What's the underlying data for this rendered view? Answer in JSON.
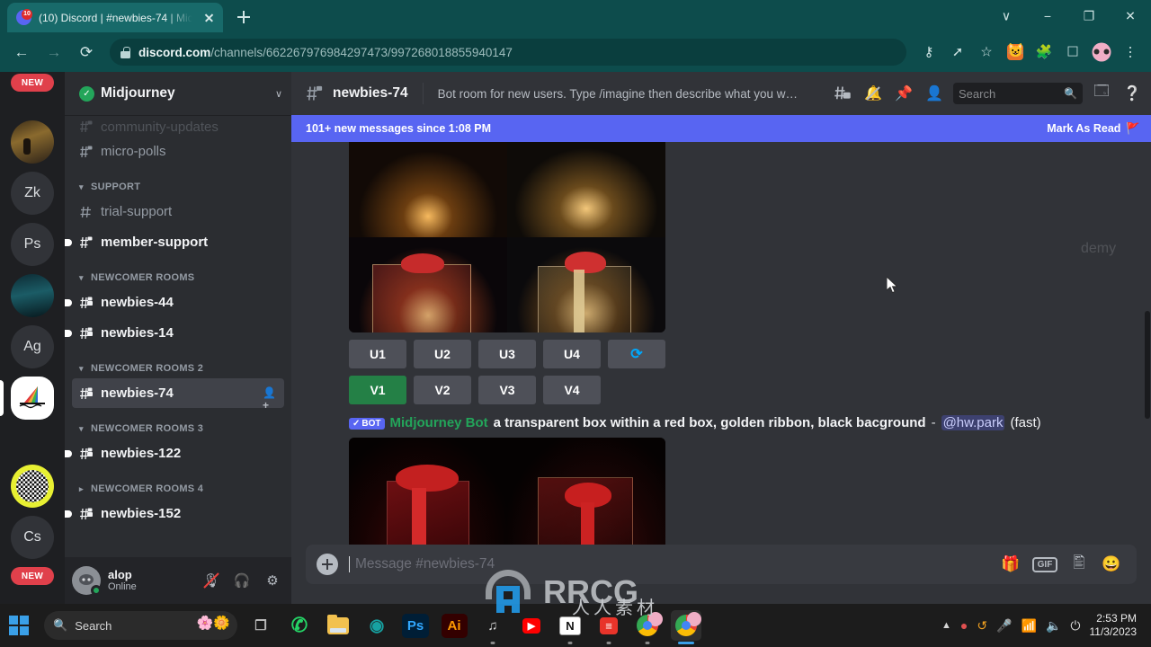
{
  "browser": {
    "tab": {
      "title": "(10) Discord | #newbies-74 | Mid",
      "badge": "10"
    },
    "url_bold": "discord.com",
    "url_rest": "/channels/662267976984297473/997268018855940147",
    "nav": {
      "back": "←",
      "forward": "→",
      "reload": "⟳"
    },
    "toolbar_icons": [
      "key-icon",
      "share-icon",
      "star-icon",
      "fox-extension-icon",
      "puzzle-icon",
      "sidepanel-icon",
      "profile-avatar",
      "kebab-menu-icon"
    ],
    "window": {
      "minimize": "−",
      "maximize": "❐",
      "close": "✕",
      "collapse": "∨"
    }
  },
  "discord": {
    "rail": [
      {
        "name": "new-badge-top",
        "label": "NEW",
        "kind": "badge"
      },
      {
        "name": "server-gold",
        "label": "",
        "kind": "image-gold"
      },
      {
        "name": "server-zk",
        "label": "Zk",
        "kind": "text"
      },
      {
        "name": "server-ps",
        "label": "Ps",
        "kind": "text"
      },
      {
        "name": "server-dark",
        "label": "",
        "kind": "image-dark"
      },
      {
        "name": "server-ag",
        "label": "Ag",
        "kind": "text"
      },
      {
        "name": "server-midjourney",
        "label": "",
        "kind": "midjourney",
        "active": true
      },
      {
        "name": "server-check",
        "label": "",
        "kind": "image-check"
      },
      {
        "name": "server-cs",
        "label": "Cs",
        "kind": "text"
      },
      {
        "name": "new-badge-bottom",
        "label": "NEW",
        "kind": "badge"
      }
    ],
    "guild": {
      "name": "Midjourney",
      "verified_glyph": "✓",
      "chevron": "∨"
    },
    "channels": [
      {
        "type": "channel",
        "name": "community-updates",
        "state": "faded-partial",
        "lock": true
      },
      {
        "type": "channel",
        "name": "micro-polls",
        "state": "normal",
        "lock": true
      },
      {
        "type": "category",
        "name": "SUPPORT"
      },
      {
        "type": "channel",
        "name": "trial-support",
        "state": "normal",
        "lock": false
      },
      {
        "type": "channel",
        "name": "member-support",
        "state": "unread",
        "lock": true
      },
      {
        "type": "category",
        "name": "NEWCOMER ROOMS"
      },
      {
        "type": "channel",
        "name": "newbies-44",
        "state": "unread",
        "lock": true
      },
      {
        "type": "channel",
        "name": "newbies-14",
        "state": "unread",
        "lock": true
      },
      {
        "type": "category",
        "name": "NEWCOMER ROOMS 2"
      },
      {
        "type": "channel",
        "name": "newbies-74",
        "state": "active",
        "lock": true,
        "invite": true
      },
      {
        "type": "category",
        "name": "NEWCOMER ROOMS 3"
      },
      {
        "type": "channel",
        "name": "newbies-122",
        "state": "unread",
        "lock": true
      },
      {
        "type": "category",
        "name": "NEWCOMER ROOMS 4",
        "collapsed": true
      },
      {
        "type": "channel",
        "name": "newbies-152",
        "state": "unread",
        "lock": true
      }
    ],
    "user": {
      "name": "alop",
      "status": "Online",
      "mic_glyph": "🎙",
      "headset_glyph": "∩",
      "gear_glyph": "⚙"
    },
    "chat_header": {
      "channel": "newbies-74",
      "topic": "Bot room for new users. Type /imagine then describe what you w…",
      "icons": [
        "threads-icon",
        "notification-mute-icon",
        "pin-icon",
        "members-icon"
      ],
      "search_placeholder": "Search",
      "inbox_icon": "inbox-icon",
      "help_icon": "help-icon"
    },
    "new_banner": {
      "text": "101+ new messages since 1:08 PM",
      "action": "Mark As Read"
    },
    "message": {
      "bot_tag": "BOT",
      "bot_check": "✓",
      "bot_name": "Midjourney Bot",
      "prompt": "a transparent box within a red box, golden ribbon, black bacground",
      "dash": "-",
      "mention": "@hw.park",
      "mode": "(fast)"
    },
    "upscale_buttons": [
      "U1",
      "U2",
      "U3",
      "U4"
    ],
    "variation_buttons": [
      "V1",
      "V2",
      "V3",
      "V4"
    ],
    "reroll_glyph": "⟳",
    "composer": {
      "placeholder": "Message #newbies-74",
      "gif_label": "GIF",
      "gift_icon": "gift-icon",
      "sticker_icon": "sticker-icon",
      "emoji_icon": "emoji-icon"
    }
  },
  "taskbar": {
    "search_placeholder": "Search",
    "apps": [
      {
        "name": "task-view",
        "glyph": "⬚",
        "color": "#b9b9b9",
        "running": false
      },
      {
        "name": "whatsapp",
        "glyph": "●",
        "color": "#25d366",
        "running": false
      },
      {
        "name": "file-explorer",
        "glyph": "",
        "color": "#f2c14e",
        "running": false
      },
      {
        "name": "camera-app",
        "glyph": "◉",
        "color": "#17a2a2",
        "running": false
      },
      {
        "name": "photoshop",
        "glyph": "Ps",
        "color": "#31a8ff",
        "running": false
      },
      {
        "name": "illustrator",
        "glyph": "Ai",
        "color": "#ff9a00",
        "running": false
      },
      {
        "name": "spotify-dark",
        "glyph": "♫",
        "color": "#cfcfcf",
        "running": true
      },
      {
        "name": "youtube",
        "glyph": "▶",
        "color": "#ff0000",
        "running": false
      },
      {
        "name": "notion",
        "glyph": "N",
        "color": "#ffffff",
        "running": true
      },
      {
        "name": "red-app",
        "glyph": "≡",
        "color": "#e8342a",
        "running": true
      },
      {
        "name": "chrome-1",
        "glyph": "",
        "color": "#4285f4",
        "running": true
      },
      {
        "name": "chrome-2",
        "glyph": "",
        "color": "#4285f4",
        "running": true,
        "active": true
      }
    ],
    "tray": [
      "show-hidden-icons",
      "record-icon",
      "sync-icon",
      "mic-icon",
      "wifi-icon",
      "volume-icon",
      "battery-icon"
    ],
    "clock": {
      "time": "2:53 PM",
      "date": "11/3/2023"
    }
  },
  "watermarks": {
    "brand": "RRCG",
    "chinese": "人人素材",
    "faint": "demy"
  },
  "colors": {
    "accent": "#5865f2",
    "green": "#23a55a",
    "brand_teal": "#0d4c4c",
    "reroll_blue": "#00a8fc"
  }
}
